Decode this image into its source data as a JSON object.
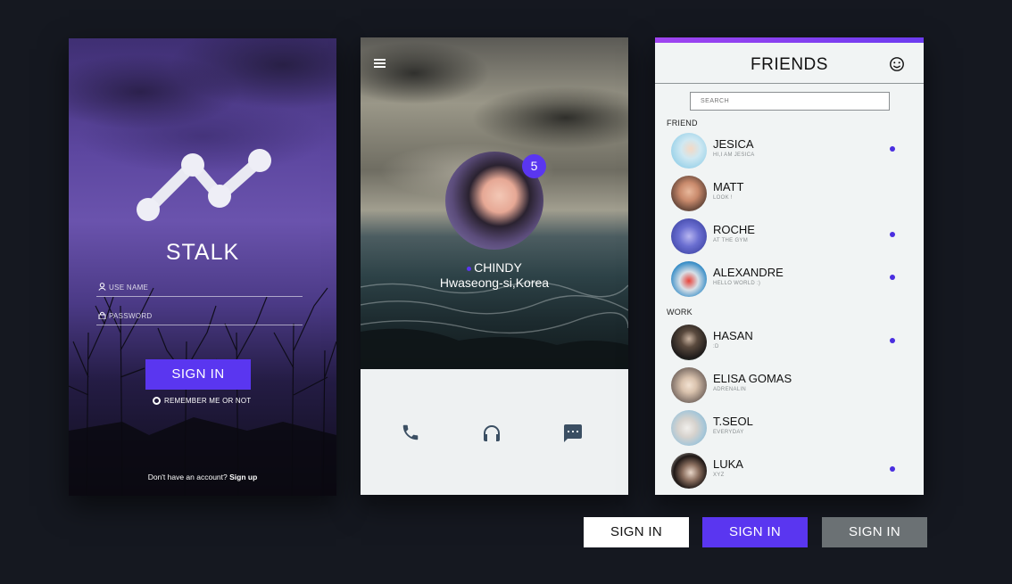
{
  "colors": {
    "accent": "#5a36f0",
    "background": "#151820",
    "panel": "#f1f4f4",
    "gray_button": "#6b7174"
  },
  "login": {
    "app_name": "STALK",
    "username_placeholder": "USE NAME",
    "password_placeholder": "PASSWORD",
    "signin_label": "SIGN IN",
    "remember_label": "REMEMBER ME OR NOT",
    "signup_prompt": "Don't have an account?",
    "signup_link": "Sign up",
    "icons": [
      "user-icon",
      "lock-icon",
      "stalk-logo"
    ]
  },
  "profile": {
    "notification_count": "5",
    "name": "CHINDY",
    "location": "Hwaseong-si,Korea",
    "icons": [
      "menu-icon",
      "phone-icon",
      "headphones-icon",
      "chat-icon"
    ]
  },
  "friends": {
    "title": "FRIENDS",
    "search_placeholder": "SEARCH",
    "sections": [
      {
        "label": "FRIEND",
        "items": [
          {
            "name": "JESICA",
            "status": "HI,I AM JESICA",
            "online": true,
            "color": "#9fd6ec"
          },
          {
            "name": "MATT",
            "status": "LOOK !",
            "online": false,
            "color": "#d9a487"
          },
          {
            "name": "ROCHE",
            "status": "AT THE GYM",
            "online": true,
            "color": "#6b6fd1"
          },
          {
            "name": "ALEXANDRE",
            "status": "HELLO WORLD :)",
            "online": true,
            "color": "#3a8fc8"
          }
        ]
      },
      {
        "label": "WORK",
        "items": [
          {
            "name": "HASAN",
            "status": ":D",
            "online": true,
            "color": "#2e2a26"
          },
          {
            "name": "ELISA GOMAS",
            "status": "ADRENALIN",
            "online": false,
            "color": "#b8c9d8"
          },
          {
            "name": "T.SEOL",
            "status": "EVERYDAY",
            "online": false,
            "color": "#a8c7d8"
          },
          {
            "name": "LUKA",
            "status": "XYZ",
            "online": true,
            "color": "#2b2220"
          }
        ]
      }
    ]
  },
  "button_variants": [
    "SIGN IN",
    "SIGN IN",
    "SIGN IN"
  ]
}
